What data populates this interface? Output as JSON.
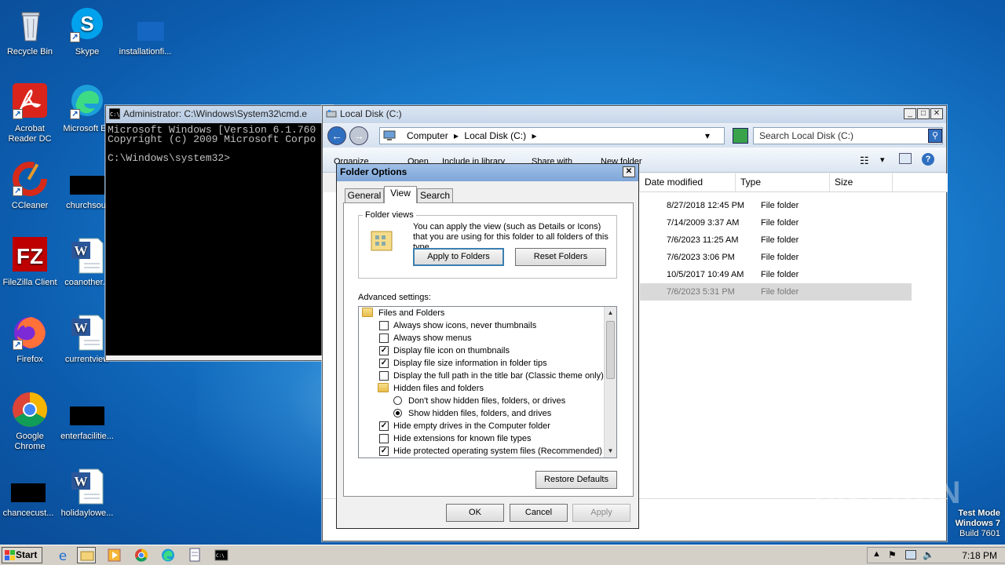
{
  "desktop": {
    "icons": [
      {
        "label": "Recycle Bin"
      },
      {
        "label": "Skype"
      },
      {
        "label": "installationfi..."
      },
      {
        "label": "Acrobat Reader DC"
      },
      {
        "label": "Microsoft Ed"
      },
      {
        "label": "CCleaner"
      },
      {
        "label": "churchsout"
      },
      {
        "label": "FileZilla Client"
      },
      {
        "label": "coanother..."
      },
      {
        "label": "Firefox"
      },
      {
        "label": "currentview"
      },
      {
        "label": "Google Chrome"
      },
      {
        "label": "enterfacilitie..."
      },
      {
        "label": "chancecust..."
      },
      {
        "label": "holidaylowe..."
      }
    ]
  },
  "cmd": {
    "title": "Administrator: C:\\Windows\\System32\\cmd.e",
    "lines": [
      "Microsoft Windows [Version 6.1.760",
      "Copyright (c) 2009 Microsoft Corpo",
      "",
      "C:\\Windows\\system32>"
    ]
  },
  "explorer": {
    "title": "Local Disk (C:)",
    "breadcrumb": [
      "Computer",
      "Local Disk (C:)"
    ],
    "search_placeholder": "Search Local Disk (C:)",
    "toolbar": {
      "organize": "Organize",
      "open": "Open",
      "include": "Include in library",
      "share": "Share with",
      "new_folder": "New folder"
    },
    "columns": {
      "date": "Date modified",
      "type": "Type",
      "size": "Size"
    },
    "rows": [
      {
        "date": "8/27/2018 12:45 PM",
        "type": "File folder"
      },
      {
        "date": "7/14/2009 3:37 AM",
        "type": "File folder"
      },
      {
        "date": "7/6/2023 11:25 AM",
        "type": "File folder"
      },
      {
        "date": "7/6/2023 3:06 PM",
        "type": "File folder"
      },
      {
        "date": "10/5/2017 10:49 AM",
        "type": "File folder"
      },
      {
        "date": "7/6/2023 5:31 PM",
        "type": "File folder"
      }
    ]
  },
  "folder_options": {
    "title": "Folder Options",
    "tabs": [
      "General",
      "View",
      "Search"
    ],
    "active_tab": "View",
    "folder_views": {
      "label": "Folder views",
      "description": "You can apply the view (such as Details or Icons) that you are using for this folder to all folders of this type.",
      "apply_button": "Apply to Folders",
      "reset_button": "Reset Folders"
    },
    "advanced_label": "Advanced settings:",
    "settings": [
      {
        "kind": "folder",
        "label": "Files and Folders"
      },
      {
        "kind": "checkbox",
        "checked": false,
        "label": "Always show icons, never thumbnails"
      },
      {
        "kind": "checkbox",
        "checked": false,
        "label": "Always show menus"
      },
      {
        "kind": "checkbox",
        "checked": true,
        "label": "Display file icon on thumbnails"
      },
      {
        "kind": "checkbox",
        "checked": true,
        "label": "Display file size information in folder tips"
      },
      {
        "kind": "checkbox",
        "checked": false,
        "label": "Display the full path in the title bar (Classic theme only)"
      },
      {
        "kind": "subfolder",
        "label": "Hidden files and folders"
      },
      {
        "kind": "radio",
        "checked": false,
        "label": "Don't show hidden files, folders, or drives"
      },
      {
        "kind": "radio",
        "checked": true,
        "label": "Show hidden files, folders, and drives"
      },
      {
        "kind": "checkbox",
        "checked": true,
        "label": "Hide empty drives in the Computer folder"
      },
      {
        "kind": "checkbox",
        "checked": false,
        "label": "Hide extensions for known file types"
      },
      {
        "kind": "checkbox",
        "checked": true,
        "label": "Hide protected operating system files (Recommended)"
      }
    ],
    "restore_defaults": "Restore Defaults",
    "ok": "OK",
    "cancel": "Cancel",
    "apply": "Apply"
  },
  "taskbar": {
    "start_label": "Start",
    "clock": "7:18 PM"
  },
  "watermark": {
    "line1": "Test Mode",
    "line2": "Windows 7",
    "line3": "Build 7601",
    "brand": "ANY RUN"
  },
  "colors": {
    "desktop_blue": "#1b7fd0",
    "title_active": "#9fc0e8",
    "selection_gray": "#d9d9d9"
  }
}
